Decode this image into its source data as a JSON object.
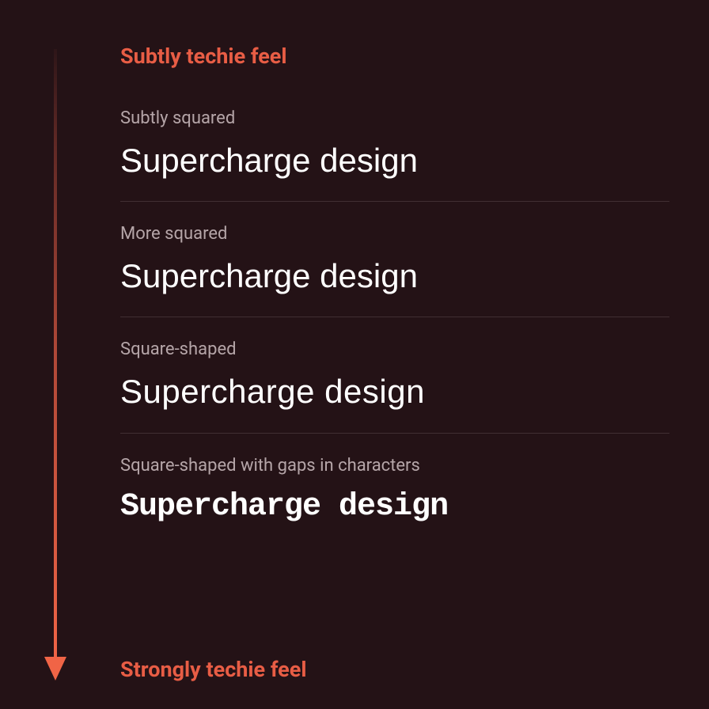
{
  "spectrum": {
    "top_label": "Subtly techie feel",
    "bottom_label": "Strongly techie feel"
  },
  "samples": [
    {
      "label": "Subtly squared",
      "text": "Supercharge design"
    },
    {
      "label": "More squared",
      "text": "Supercharge design"
    },
    {
      "label": "Square-shaped",
      "text": "Supercharge design"
    },
    {
      "label": "Square-shaped with gaps in characters",
      "text": "Supercharge design"
    }
  ],
  "colors": {
    "background": "#241216",
    "accent": "#e85d45",
    "text_primary": "#ffffff",
    "text_secondary": "#b5a5a8"
  }
}
